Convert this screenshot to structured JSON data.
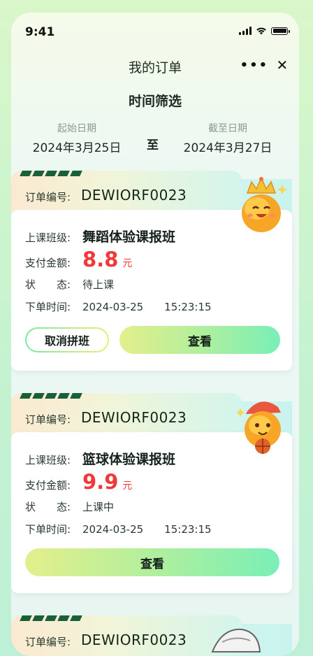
{
  "status_bar": {
    "time": "9:41"
  },
  "nav": {
    "title": "我的订单",
    "more_icon": "more-dots-icon",
    "close_icon": "close-icon"
  },
  "filter": {
    "title": "时间筛选",
    "start_label": "起始日期",
    "start_value": "2024年3月25日",
    "separator": "至",
    "end_label": "截至日期",
    "end_value": "2024年3月27日"
  },
  "orders": [
    {
      "no_label": "订单编号:",
      "no": "DEWIORF0023",
      "class_label": "上课班级:",
      "class_name": "舞蹈体验课报班",
      "amount_label": "支付金额:",
      "amount": "8.8",
      "unit": "元",
      "status_label": "状　　态:",
      "status": "待上课",
      "time_label": "下单时间:",
      "time": "2024-03-25  15:23:15",
      "cancel_label": "取消拼班",
      "view_label": "查看"
    },
    {
      "no_label": "订单编号:",
      "no": "DEWIORF0023",
      "class_label": "上课班级:",
      "class_name": "篮球体验课报班",
      "amount_label": "支付金额:",
      "amount": "9.9",
      "unit": "元",
      "status_label": "状　　态:",
      "status": "上课中",
      "time_label": "下单时间:",
      "time": "2024-03-25  15:23:15",
      "view_label": "查看"
    },
    {
      "no_label": "订单编号:",
      "no": "DEWIORF0023"
    }
  ],
  "colors": {
    "price": "#f03a3a",
    "stripe": "#19603a"
  }
}
